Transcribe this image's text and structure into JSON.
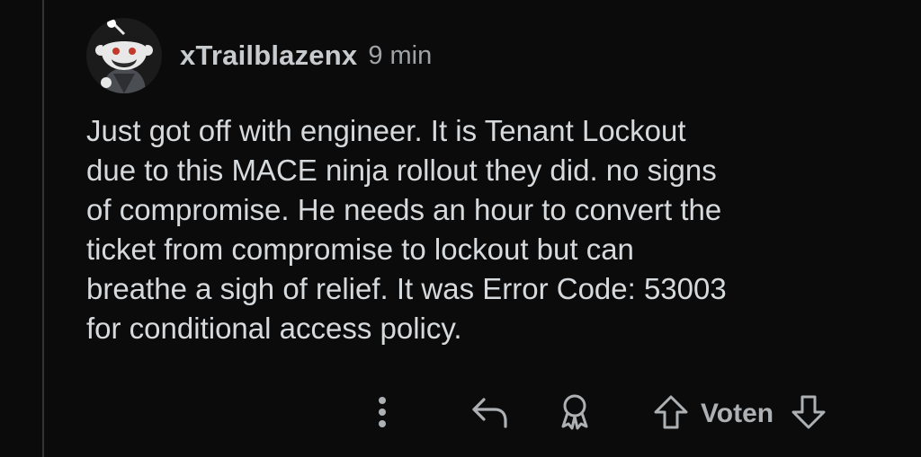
{
  "comment": {
    "username": "xTrailblazenx",
    "time": "9 min",
    "body": "Just got off with engineer. It is Tenant Lockout\ndue to this MACE ninja rollout they did. no signs\nof compromise. He needs an hour to convert the\nticket from compromise to lockout but can\nbreathe a sigh of relief. It was Error Code: 53003\nfor conditional access policy."
  },
  "actions": {
    "more_icon": "more-vertical-icon",
    "reply_icon": "reply-arrow-icon",
    "award_icon": "award-icon",
    "upvote_icon": "upvote-arrow-icon",
    "vote_label": "Voten",
    "downvote_icon": "downvote-arrow-icon"
  },
  "colors": {
    "background": "#0b0b0c",
    "text": "#d7dadc",
    "muted": "#9fa3a6",
    "thread_line": "#343536"
  }
}
